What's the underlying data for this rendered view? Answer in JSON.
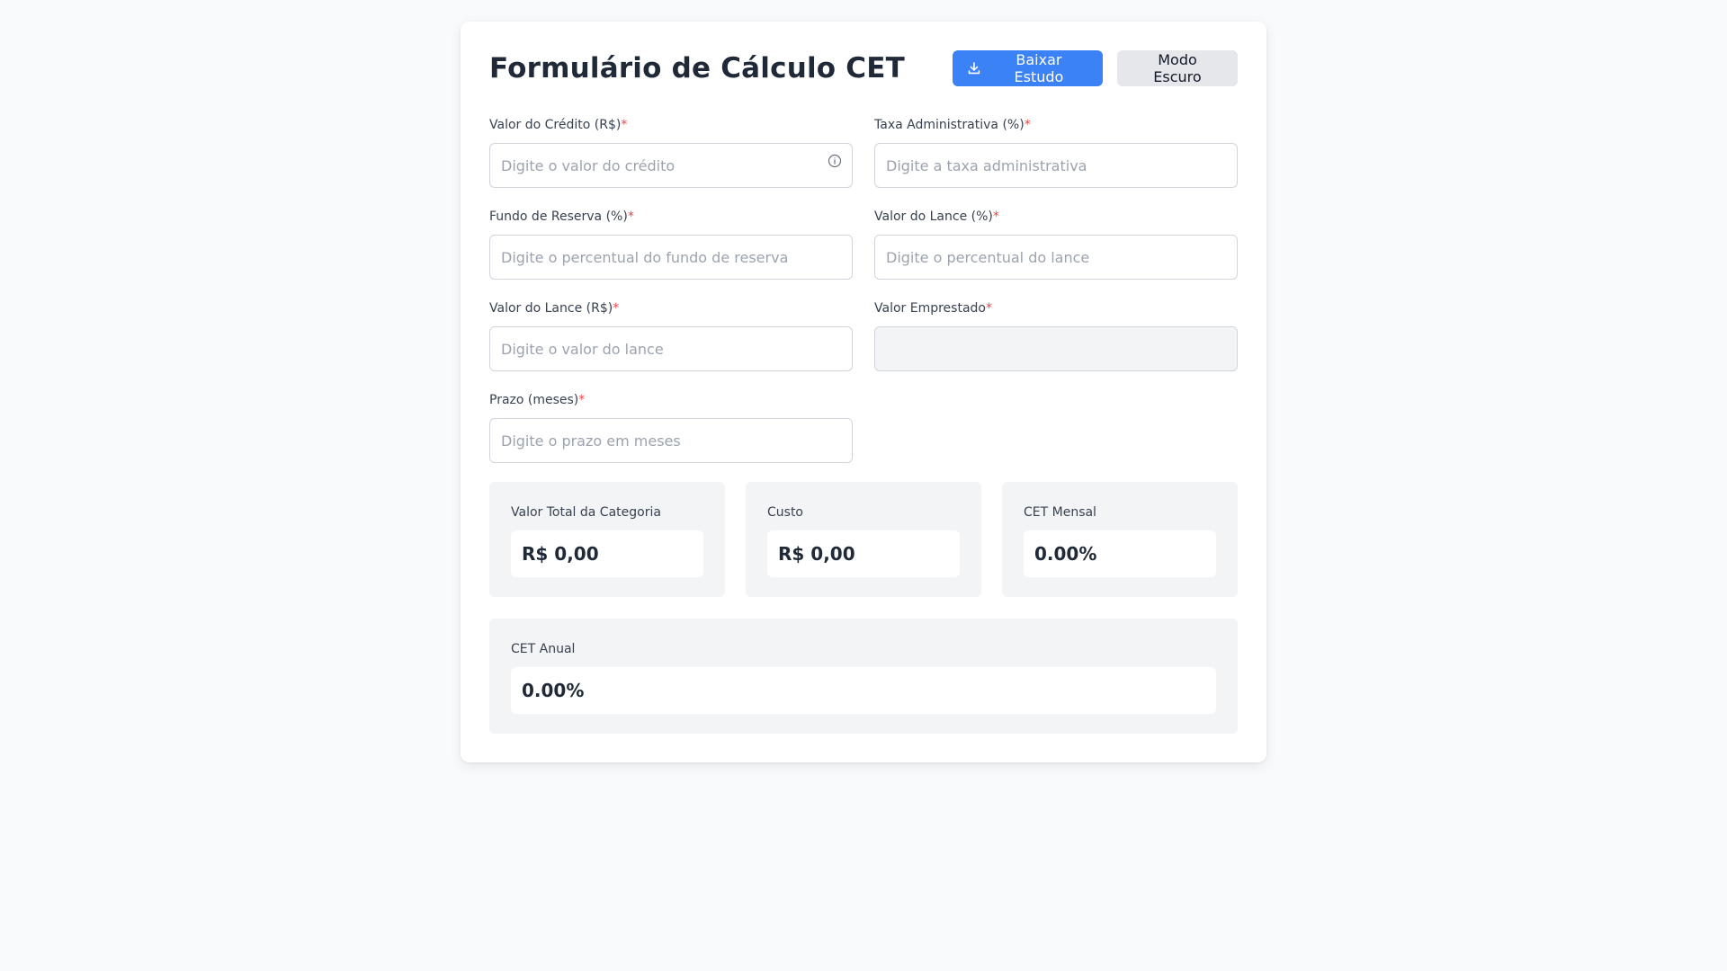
{
  "form": {
    "title": "Formulário de Cálculo CET",
    "download_label": "Baixar Estudo",
    "dark_mode_label": "Modo Escuro",
    "required_mark": "*",
    "fields": {
      "valor_credito": {
        "label": "Valor do Crédito (R$)",
        "placeholder": "Digite o valor do crédito",
        "value": ""
      },
      "taxa_admin": {
        "label": "Taxa Administrativa (%)",
        "placeholder": "Digite a taxa administrativa",
        "value": ""
      },
      "fundo_reserva": {
        "label": "Fundo de Reserva (%)",
        "placeholder": "Digite o percentual do fundo de reserva",
        "value": ""
      },
      "lance_pct": {
        "label": "Valor do Lance (%)",
        "placeholder": "Digite o percentual do lance",
        "value": ""
      },
      "lance_rs": {
        "label": "Valor do Lance (R$)",
        "placeholder": "Digite o valor do lance",
        "value": ""
      },
      "valor_emprestado": {
        "label": "Valor Emprestado",
        "placeholder": "",
        "value": ""
      },
      "prazo": {
        "label": "Prazo (meses)",
        "placeholder": "Digite o prazo em meses",
        "value": ""
      }
    }
  },
  "results": {
    "total_categoria": {
      "label": "Valor Total da Categoria",
      "value": "R$ 0,00"
    },
    "custo": {
      "label": "Custo",
      "value": "R$ 0,00"
    },
    "cet_mensal": {
      "label": "CET Mensal",
      "value": "0.00%"
    },
    "cet_anual": {
      "label": "CET Anual",
      "value": "0.00%"
    }
  },
  "icons": {
    "download": "download-icon",
    "info": "info-icon"
  },
  "colors": {
    "primary": "#3b82f6",
    "required": "#ef4444",
    "panel": "#f3f4f6"
  }
}
